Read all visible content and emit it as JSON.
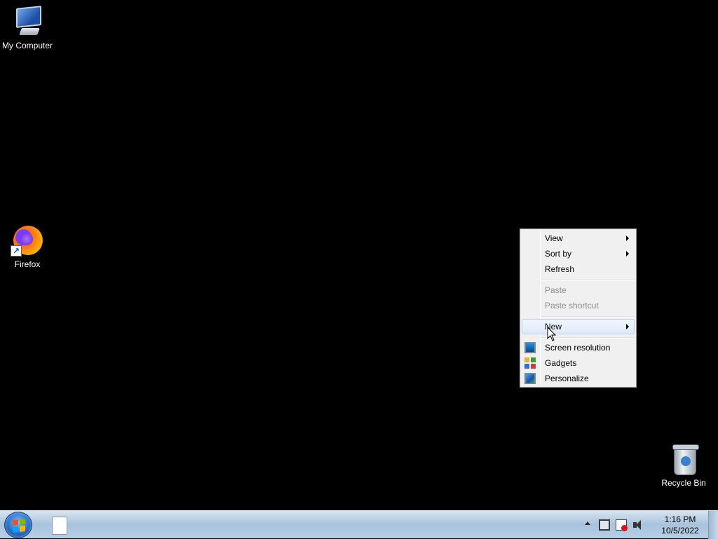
{
  "desktop": {
    "icons": {
      "my_computer": {
        "label": "My Computer",
        "icon": "computer-icon"
      },
      "firefox": {
        "label": "Firefox",
        "icon": "firefox-icon"
      },
      "recycle_bin": {
        "label": "Recycle Bin",
        "icon": "recycle-bin-icon"
      }
    },
    "background_color": "#000000"
  },
  "context_menu": {
    "items": [
      {
        "label": "View",
        "submenu": true,
        "enabled": true
      },
      {
        "label": "Sort by",
        "submenu": true,
        "enabled": true
      },
      {
        "label": "Refresh",
        "submenu": false,
        "enabled": true
      },
      {
        "label": "Paste",
        "submenu": false,
        "enabled": false
      },
      {
        "label": "Paste shortcut",
        "submenu": false,
        "enabled": false
      },
      {
        "label": "New",
        "submenu": true,
        "enabled": true,
        "highlighted": true
      },
      {
        "label": "Screen resolution",
        "submenu": false,
        "enabled": true,
        "icon": "screen-resolution-icon"
      },
      {
        "label": "Gadgets",
        "submenu": false,
        "enabled": true,
        "icon": "gadgets-icon"
      },
      {
        "label": "Personalize",
        "submenu": false,
        "enabled": true,
        "icon": "personalize-icon"
      }
    ]
  },
  "taskbar": {
    "start_button": {
      "icon": "windows-start-icon"
    },
    "pinned": [
      {
        "icon": "document-icon"
      }
    ],
    "tray_icons": [
      "show-hidden-icons-arrow",
      "network-icon",
      "action-center-flag-icon",
      "volume-icon"
    ],
    "clock": {
      "time": "1:16 PM",
      "date": "10/5/2022"
    }
  }
}
